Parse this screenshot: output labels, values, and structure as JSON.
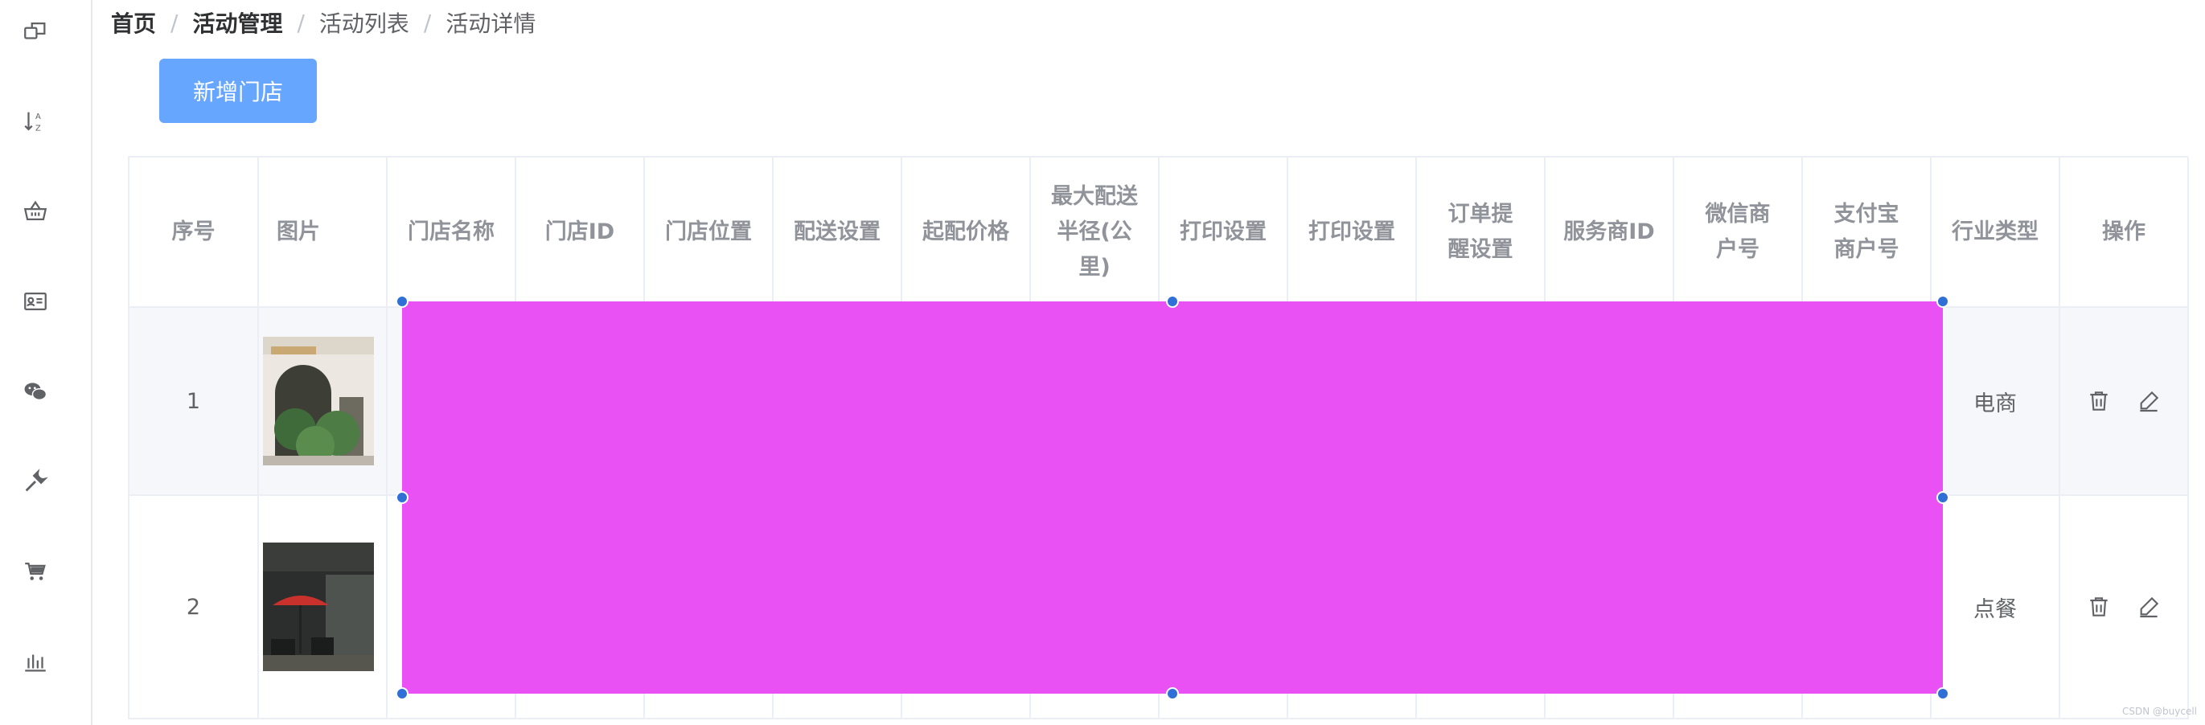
{
  "sidebar": {
    "items": [
      {
        "icon": "window-copy-icon"
      },
      {
        "icon": "sort-az-icon"
      },
      {
        "icon": "basket-icon"
      },
      {
        "icon": "id-card-icon"
      },
      {
        "icon": "wechat-icon"
      },
      {
        "icon": "wrench-icon"
      },
      {
        "icon": "cart-icon"
      },
      {
        "icon": "bar-chart-icon"
      }
    ]
  },
  "breadcrumb": {
    "home": "首页",
    "section": "活动管理",
    "list": "活动列表",
    "current": "活动详情",
    "separator": "/"
  },
  "toolbar": {
    "add_label": "新增门店"
  },
  "table": {
    "headers": [
      "序号",
      "图片",
      "门店名称",
      "门店ID",
      "门店位置",
      "配送设置",
      "起配价格",
      "最大配送半径(公里)",
      "打印设置",
      "打印设置",
      "订单提醒设置",
      "服务商ID",
      "微信商户号",
      "支付宝商户号",
      "行业类型",
      "操作"
    ],
    "rows": [
      {
        "index": "1",
        "image": "storefront-photo",
        "industry": "电商"
      },
      {
        "index": "2",
        "image": "patio-photo",
        "industry": "点餐"
      }
    ]
  },
  "colors": {
    "accent_button": "#66a6ff",
    "redaction": "#ea51f5",
    "handle": "#2f6fd6"
  },
  "watermark": "CSDN @buycell"
}
